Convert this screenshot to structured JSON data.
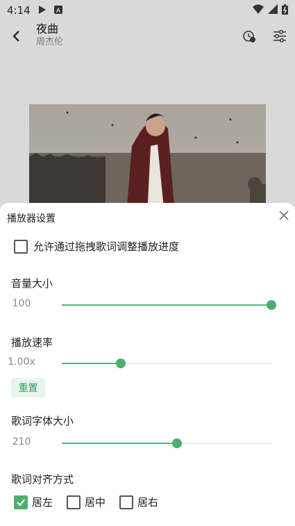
{
  "status_bar": {
    "time": "4:14"
  },
  "header": {
    "title": "夜曲",
    "artist": "周杰伦"
  },
  "sheet": {
    "title": "播放器设置",
    "drag_seek_label": "允许通过拖拽歌词调整播放进度",
    "drag_seek_checked": false,
    "volume": {
      "label": "音量大小",
      "value_text": "100",
      "fraction": 1.0
    },
    "speed": {
      "label": "播放速率",
      "value_text": "1.00x",
      "fraction": 0.28,
      "reset_label": "重置"
    },
    "font_size": {
      "label": "歌词字体大小",
      "value_text": "210",
      "fraction": 0.55
    },
    "alignment": {
      "label": "歌词对齐方式",
      "options": [
        {
          "label": "居左",
          "checked": true
        },
        {
          "label": "居中",
          "checked": false
        },
        {
          "label": "居右",
          "checked": false
        }
      ]
    }
  },
  "colors": {
    "accent": "#4caf6e",
    "track": "#e2f0e7"
  }
}
